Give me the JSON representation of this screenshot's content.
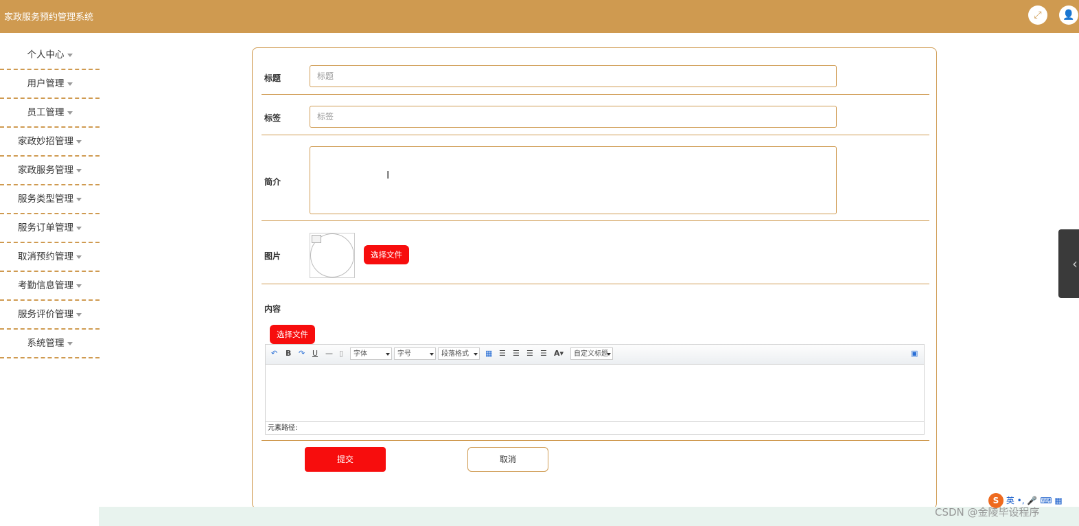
{
  "header": {
    "title": "家政服务预约管理系统",
    "icons": [
      "fullscreen-icon",
      "user-icon"
    ]
  },
  "sidebar": {
    "items": [
      {
        "label": "个人中心"
      },
      {
        "label": "用户管理"
      },
      {
        "label": "员工管理"
      },
      {
        "label": "家政妙招管理"
      },
      {
        "label": "家政服务管理"
      },
      {
        "label": "服务类型管理"
      },
      {
        "label": "服务订单管理"
      },
      {
        "label": "取消预约管理"
      },
      {
        "label": "考勤信息管理"
      },
      {
        "label": "服务评价管理"
      },
      {
        "label": "系统管理"
      }
    ]
  },
  "form": {
    "title_label": "标题",
    "title_placeholder": "标题",
    "tag_label": "标签",
    "tag_placeholder": "标签",
    "intro_label": "简介",
    "image_label": "图片",
    "image_button": "选择文件",
    "content_label": "内容",
    "content_button": "选择文件",
    "submit": "提交",
    "cancel": "取消"
  },
  "editor": {
    "font_select": "字体",
    "size_select": "字号",
    "paragraph_select": "段落格式",
    "custom_title_select": "自定义标题",
    "path_label": "元素路径:"
  },
  "overlay": {
    "watermark": "CSDN @金陵毕设程序",
    "ime_logo": "S",
    "ime_lang": "英"
  },
  "colors": {
    "accent": "#cf9a50",
    "button_red": "#f70d0d"
  }
}
